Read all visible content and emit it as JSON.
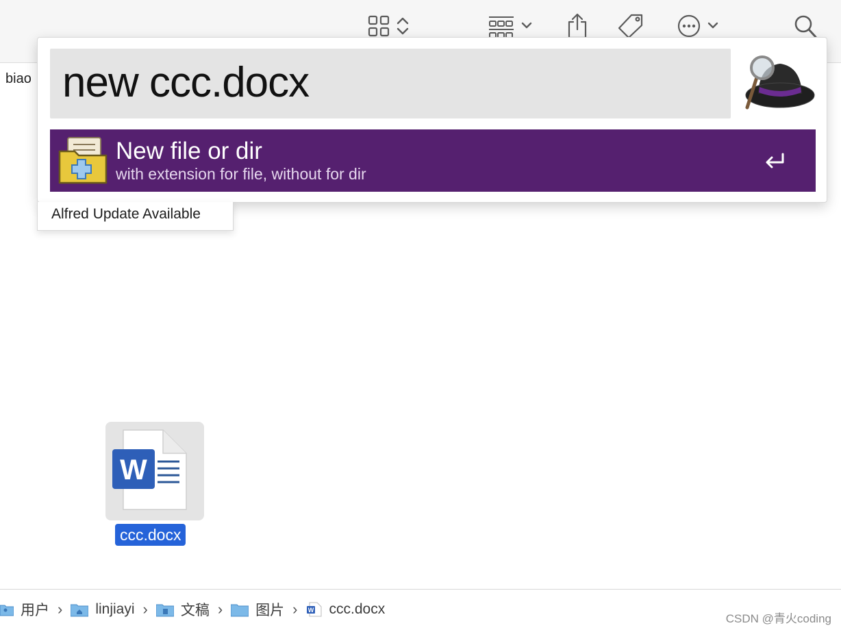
{
  "finder": {
    "sidebar_stub_text": "biao"
  },
  "toolbar": {
    "icons": [
      "grid-view-icon",
      "sort-chevrons-icon",
      "group-icon",
      "share-icon",
      "tag-icon",
      "more-icon",
      "search-icon"
    ]
  },
  "alfred": {
    "query": "new ccc.docx",
    "result": {
      "title": "New file or dir",
      "subtitle": "with extension for file, without for dir"
    },
    "update_notice": "Alfred Update Available",
    "accent_color": "#55206f"
  },
  "file": {
    "name": "ccc.docx",
    "selection_color": "#2563d9"
  },
  "path_bar": {
    "items": [
      "用户",
      "linjiayi",
      "文稿",
      "图片",
      "ccc.docx"
    ]
  },
  "watermark": "CSDN @青火coding"
}
